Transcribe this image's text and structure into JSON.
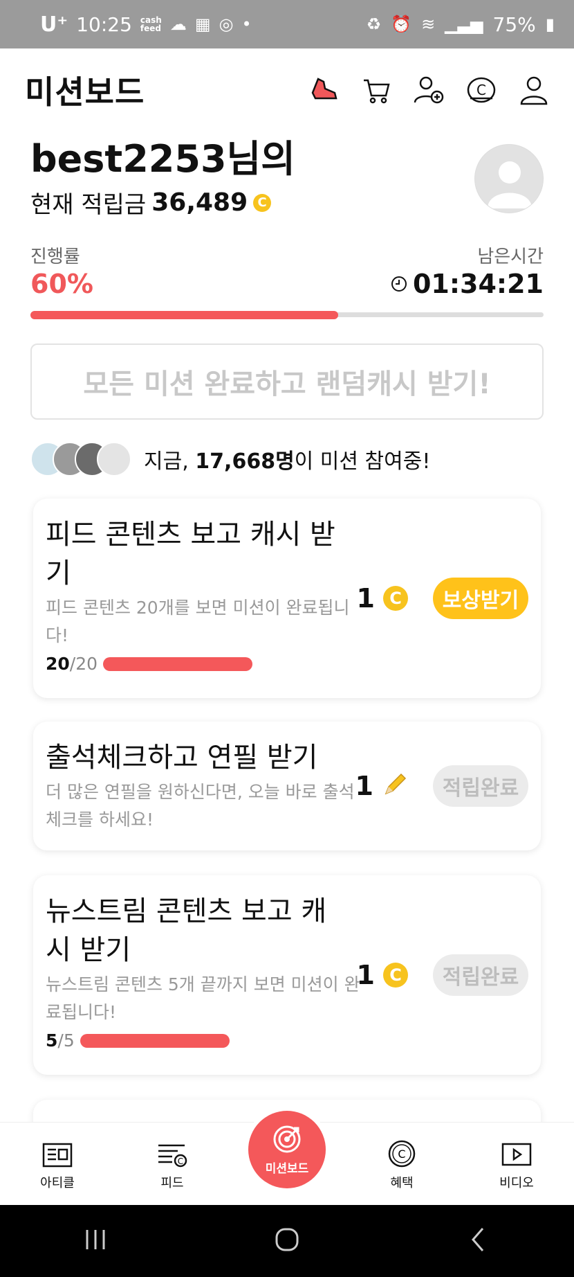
{
  "status_bar": {
    "carrier": "U⁺",
    "time": "10:25",
    "cashfeed_label_1": "cash",
    "cashfeed_label_2": "feed",
    "battery": "75%"
  },
  "header": {
    "title": "미션보드",
    "icons": [
      "shoe-icon",
      "cart-icon",
      "add-friend-icon",
      "coin-icon",
      "profile-icon"
    ]
  },
  "user": {
    "name": "best2253님의",
    "points_label": "현재 적립금",
    "points_value": "36,489",
    "coin_symbol": "C"
  },
  "progress": {
    "label": "진행률",
    "value": "60%",
    "fraction": 0.6,
    "time_label": "남은시간",
    "time_value": "01:34:21"
  },
  "complete_all": {
    "label": "모든 미션 완료하고 랜덤캐시 받기!"
  },
  "participants": {
    "prefix": "지금,",
    "count": "17,668명",
    "suffix": "이 미션 참여중!"
  },
  "missions": [
    {
      "title": "피드 콘텐츠 보고 캐시 받기",
      "desc": "피드 콘텐츠 20개를 보면 미션이 완료됩니다!",
      "done": "20",
      "total": "/20",
      "progress_fraction": 1.0,
      "reward": "1",
      "reward_type": "coin",
      "button": "보상받기",
      "button_state": "active"
    },
    {
      "title": "출석체크하고 연필 받기",
      "desc": "더 많은 연필을 원하신다면, 오늘 바로 출석체크를 하세요!",
      "reward": "1",
      "reward_type": "pencil",
      "button": "적립완료",
      "button_state": "done"
    },
    {
      "title": "뉴스트림 콘텐츠 보고 캐시 받기",
      "desc": "뉴스트림 콘텐츠 5개 끝까지 보면 미션이 완료됩니다!",
      "done": "5",
      "total": "/5",
      "progress_fraction": 1.0,
      "reward": "1",
      "reward_type": "coin",
      "button": "적립완료",
      "button_state": "done"
    }
  ],
  "bottom_nav": {
    "article": "아티클",
    "feed": "피드",
    "missionboard": "미션보드",
    "benefit": "혜택",
    "video": "비디오"
  },
  "colors": {
    "accent": "#f4585a",
    "coin": "#f7c31e",
    "reward_button": "#ffc21a"
  }
}
